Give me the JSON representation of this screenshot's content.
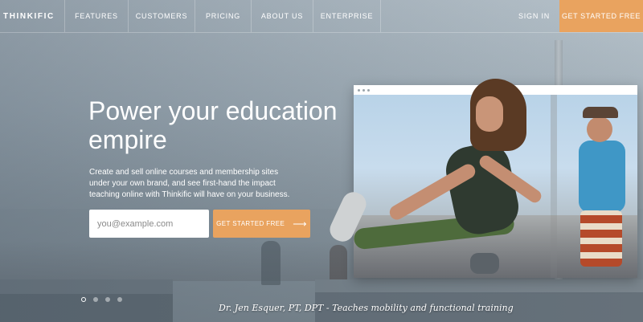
{
  "brand": {
    "logo": "THINKIFIC",
    "accent": "#e9a35f"
  },
  "nav": {
    "items": [
      "FEATURES",
      "CUSTOMERS",
      "PRICING",
      "ABOUT US",
      "ENTERPRISE"
    ],
    "signin": "SIGN IN",
    "cta": "GET STARTED FREE"
  },
  "hero": {
    "headline": "Power your education empire",
    "subtext": "Create and sell online courses and membership sites under your own brand, and see first-hand the impact teaching online with Thinkific will have on your business.",
    "email_placeholder": "you@example.com",
    "cta_label": "GET STARTED FREE",
    "cta_icon": "arrow-right-icon",
    "caption": "Dr. Jen Esquer, PT, DPT - Teaches mobility and functional training"
  },
  "carousel": {
    "count": 4,
    "active": 0
  }
}
